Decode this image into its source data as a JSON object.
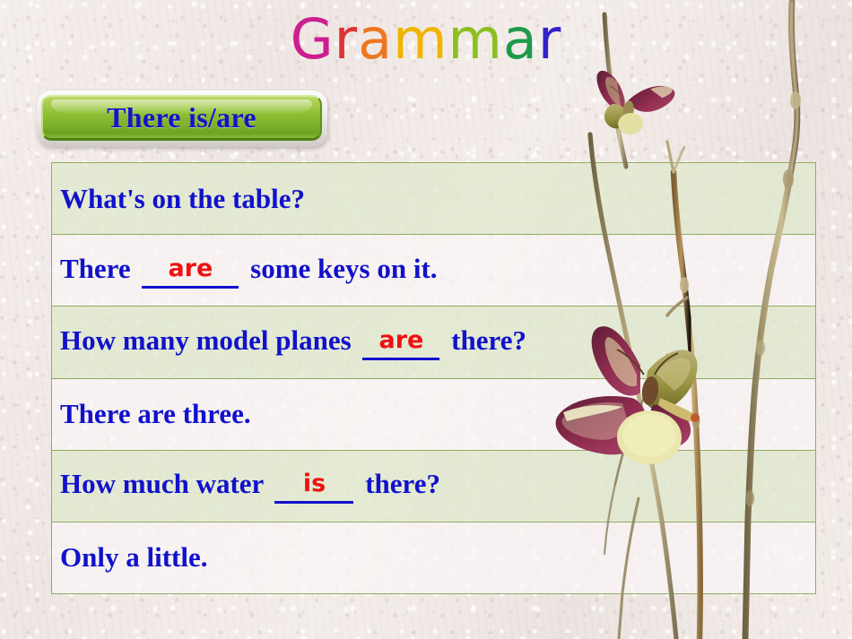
{
  "slide": {
    "title": "Grammar",
    "title_letters": [
      {
        "char": "G",
        "color": "#cc1f8f"
      },
      {
        "char": "r",
        "color": "#dd3333"
      },
      {
        "char": "a",
        "color": "#ee7722"
      },
      {
        "char": "m",
        "color": "#f0b400"
      },
      {
        "char": "m",
        "color": "#8cbf1f"
      },
      {
        "char": "a",
        "color": "#1d9a4a"
      },
      {
        "char": "r",
        "color": "#3322cc"
      }
    ],
    "background_color": "#f3ece9"
  },
  "topic_button": {
    "label": "There is/are",
    "text_color": "#1414c8",
    "fill_color": "#8dbf33"
  },
  "table": {
    "border_color": "#93ab63",
    "shade_color": "#e0e8cd",
    "light_color": "#faf6f6",
    "text_color": "#1111cc",
    "answer_color": "#ee1111",
    "rows": [
      {
        "shade": "shade",
        "segments": [
          {
            "type": "text",
            "value": "What's on the table?"
          }
        ]
      },
      {
        "shade": "light",
        "segments": [
          {
            "type": "text",
            "value": "There "
          },
          {
            "type": "blank",
            "value": "are",
            "width": "w-wide"
          },
          {
            "type": "text",
            "value": " some keys on it."
          }
        ]
      },
      {
        "shade": "shade",
        "segments": [
          {
            "type": "text",
            "value": "How many model planes "
          },
          {
            "type": "blank",
            "value": "are",
            "width": "w-mid"
          },
          {
            "type": "text",
            "value": " there?"
          }
        ]
      },
      {
        "shade": "light",
        "segments": [
          {
            "type": "text",
            "value": "There are three."
          }
        ]
      },
      {
        "shade": "shade",
        "segments": [
          {
            "type": "text",
            "value": "How much water "
          },
          {
            "type": "blank",
            "value": "is",
            "width": "w-nar"
          },
          {
            "type": "text",
            "value": " there?"
          }
        ]
      },
      {
        "shade": "light",
        "segments": [
          {
            "type": "text",
            "value": "Only a little."
          }
        ]
      }
    ]
  },
  "decoration": {
    "items": [
      {
        "name": "butterfly-small",
        "wing_dark": "#7d2a45",
        "wing_light": "#d8d2a0"
      },
      {
        "name": "butterfly-large",
        "wing_dark": "#8e2b4e",
        "wing_light": "#e4dfae"
      },
      {
        "name": "twig-left",
        "color": "#9a8f6a"
      },
      {
        "name": "twig-right",
        "color": "#a88b5e"
      }
    ]
  }
}
